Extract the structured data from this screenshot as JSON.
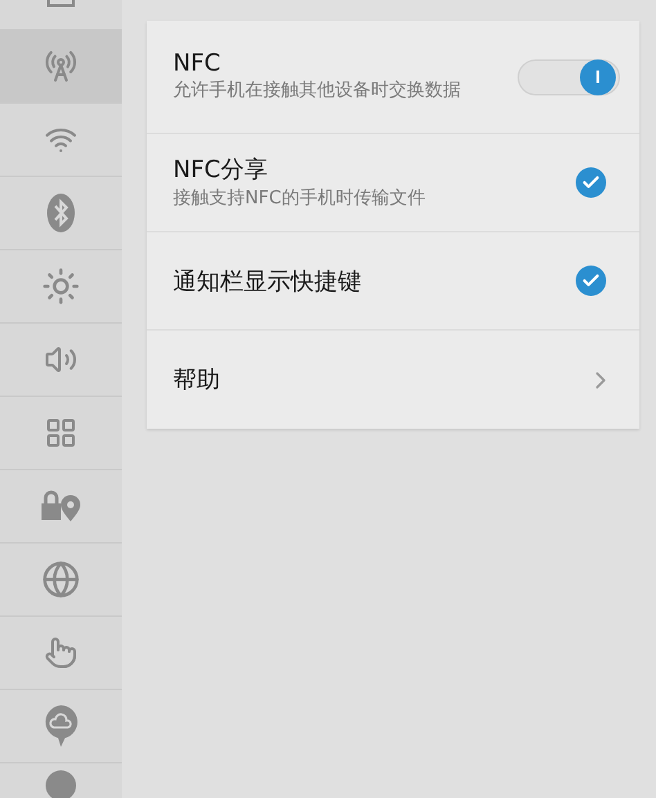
{
  "sidebar": {
    "items": [
      {
        "selected": false
      },
      {
        "selected": true
      },
      {
        "selected": false
      },
      {
        "selected": false
      },
      {
        "selected": false
      },
      {
        "selected": false
      },
      {
        "selected": false
      },
      {
        "selected": false
      },
      {
        "selected": false
      },
      {
        "selected": false
      },
      {
        "selected": false
      },
      {
        "selected": false
      }
    ]
  },
  "settings": [
    {
      "kind": "toggle",
      "title": "NFC",
      "subtitle": "允许手机在接触其他设备时交换数据",
      "on": true
    },
    {
      "kind": "check",
      "title": "NFC分享",
      "subtitle": "接触支持NFC的手机时传输文件",
      "checked": true
    },
    {
      "kind": "check",
      "title": "通知栏显示快捷键",
      "checked": true
    },
    {
      "kind": "link",
      "title": "帮助"
    }
  ]
}
